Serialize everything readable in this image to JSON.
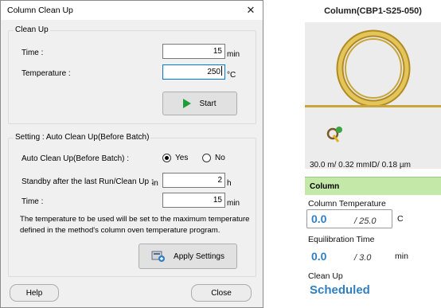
{
  "dialog": {
    "title": "Column Clean Up",
    "close_glyph": "✕",
    "clean_up": {
      "group_label": "Clean Up",
      "time_label": "Time :",
      "time_value": "15",
      "time_unit": "min",
      "temperature_label": "Temperature :",
      "temperature_value": "250",
      "temperature_unit": "°C",
      "start_label": "Start"
    },
    "setting": {
      "group_label": "Setting : Auto Clean Up(Before Batch)",
      "auto_label": "Auto Clean Up(Before Batch) :",
      "yes_label": "Yes",
      "no_label": "No",
      "selected": "Yes",
      "standby_label": "Standby after the last Run/Clean Up :",
      "standby_in": "in",
      "standby_value": "2",
      "standby_unit": "h",
      "time_label": "Time :",
      "time_value": "15",
      "time_unit": "min",
      "note": "The temperature to be used will be set to the maximum temperature defined in the method's column oven temperature program.",
      "apply_label": "Apply Settings"
    },
    "help_label": "Help",
    "close_label": "Close"
  },
  "column_panel": {
    "title": "Column(CBP1-S25-050)",
    "spec": "30.0 m/  0.32 mmID/ 0.18  µm",
    "section_header": "Column",
    "column_temp_label": "Column Temperature",
    "column_temp_current": "0.0",
    "column_temp_set": "/ 25.0",
    "column_temp_unit": "C",
    "equil_label": "Equilibration Time",
    "equil_current": "0.0",
    "equil_set": "/ 3.0",
    "equil_unit": "min",
    "cleanup_label": "Clean Up",
    "cleanup_status": "Scheduled"
  },
  "colors": {
    "accent_blue": "#2f7fc1",
    "header_green": "#c3e8a8",
    "coil_gold": "#c7a63a",
    "start_green": "#1e9e36"
  }
}
